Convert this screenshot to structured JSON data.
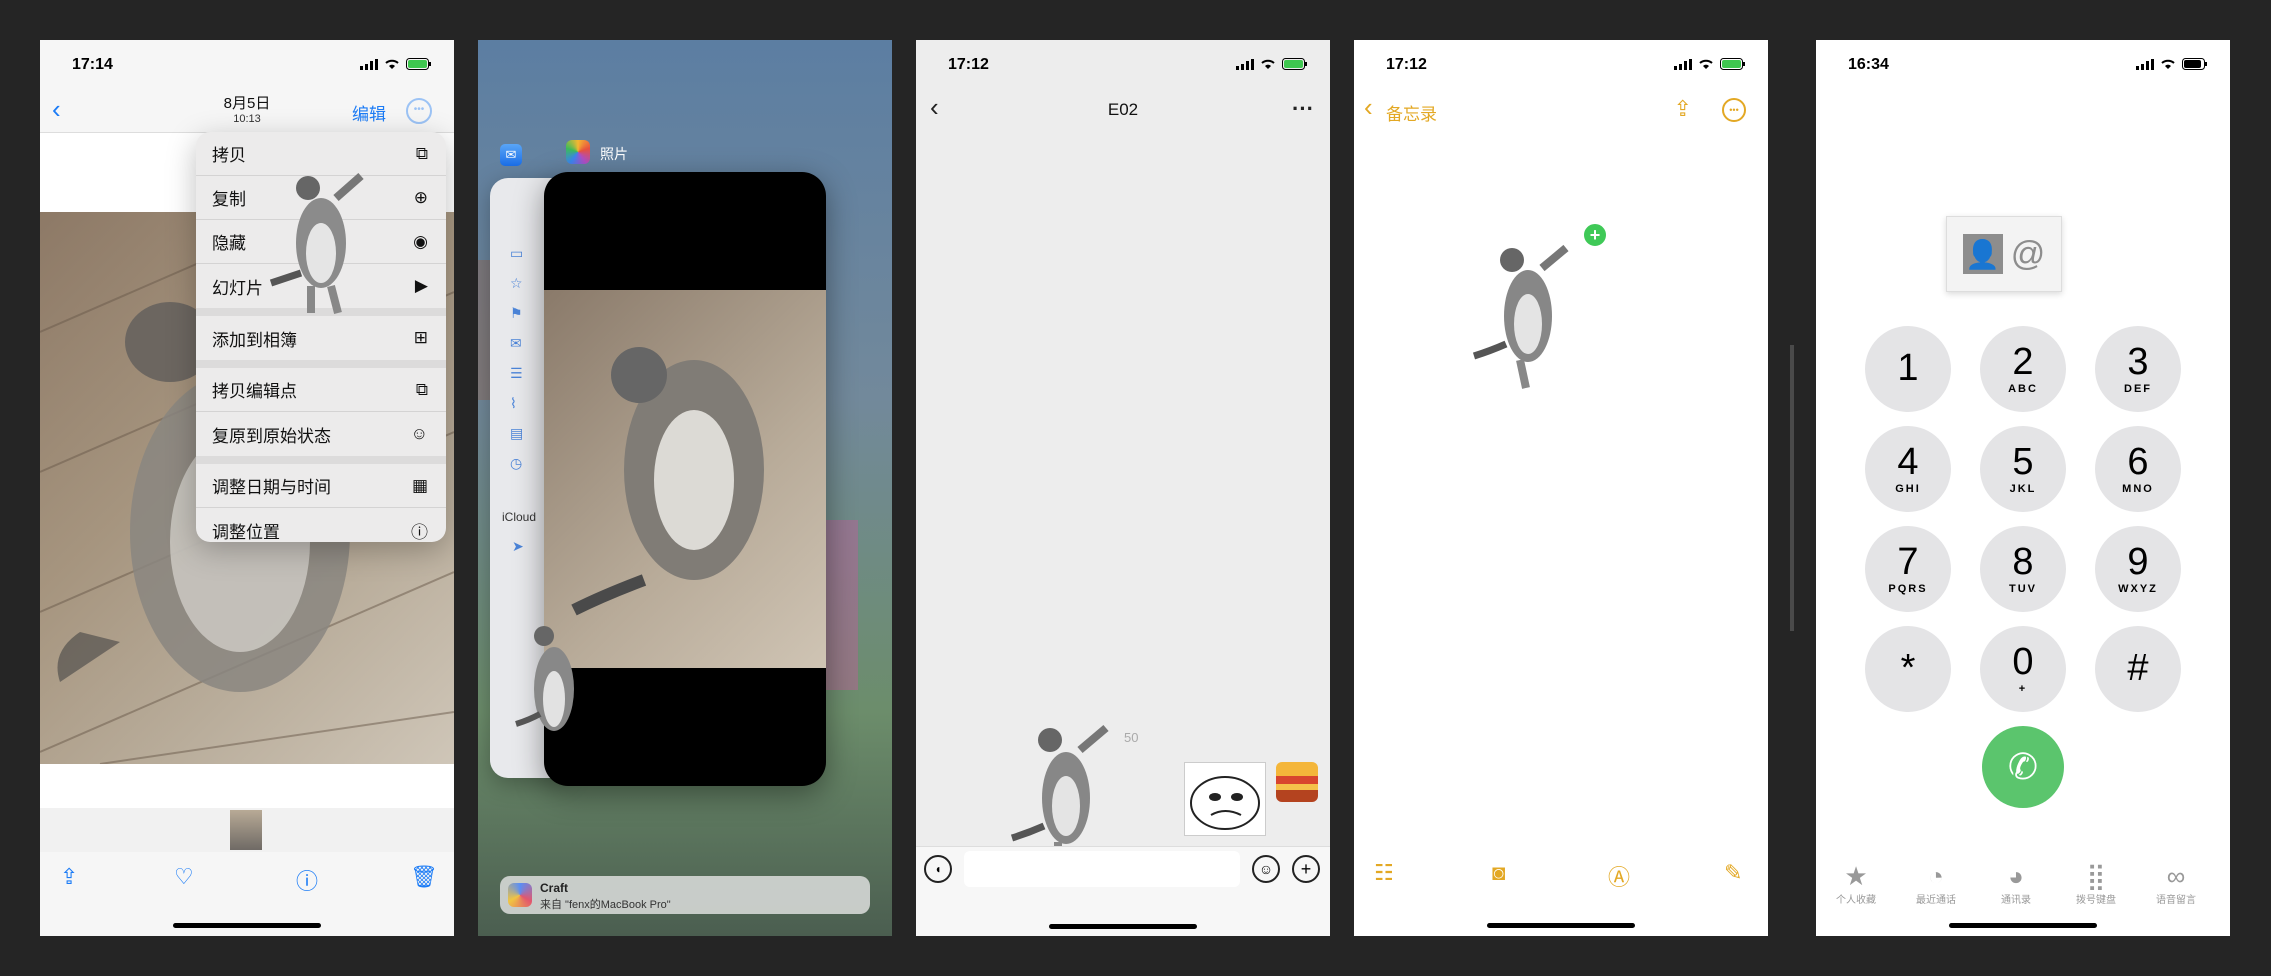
{
  "colors": {
    "ios_blue": "#1c7cf6",
    "notes_yellow": "#e3a824",
    "call_green": "#5bc56d",
    "dark_bg": "#252525"
  },
  "phone1": {
    "time": "17:14",
    "date": "8月5日",
    "subtime": "10:13",
    "edit_label": "编辑",
    "menu": [
      "拷贝",
      "复制",
      "隐藏",
      "幻灯片",
      "添加到相簿",
      "拷贝编辑点",
      "复原到原始状态",
      "调整日期与时间",
      "调整位置"
    ],
    "toolbar_icons": [
      "share-icon",
      "heart-icon",
      "info-icon",
      "trash-icon"
    ]
  },
  "phone2": {
    "app_label": "照片",
    "icloud_label": "iCloud",
    "handoff_title": "Craft",
    "handoff_subtitle": "来自 \"fenx的MacBook Pro\""
  },
  "phone3": {
    "time": "17:12",
    "title": "E02",
    "more": "···",
    "faint_time": "50"
  },
  "phone4": {
    "time": "17:12",
    "back_label": "备忘录"
  },
  "phone5": {
    "time": "16:34",
    "keys": [
      {
        "d": "1",
        "l": ""
      },
      {
        "d": "2",
        "l": "ABC"
      },
      {
        "d": "3",
        "l": "DEF"
      },
      {
        "d": "4",
        "l": "GHI"
      },
      {
        "d": "5",
        "l": "JKL"
      },
      {
        "d": "6",
        "l": "MNO"
      },
      {
        "d": "7",
        "l": "PQRS"
      },
      {
        "d": "8",
        "l": "TUV"
      },
      {
        "d": "9",
        "l": "WXYZ"
      },
      {
        "d": "*",
        "l": ""
      },
      {
        "d": "0",
        "l": "+"
      },
      {
        "d": "#",
        "l": ""
      }
    ],
    "tabs": [
      "个人收藏",
      "最近通话",
      "通讯录",
      "拨号键盘",
      "语音留言"
    ]
  }
}
